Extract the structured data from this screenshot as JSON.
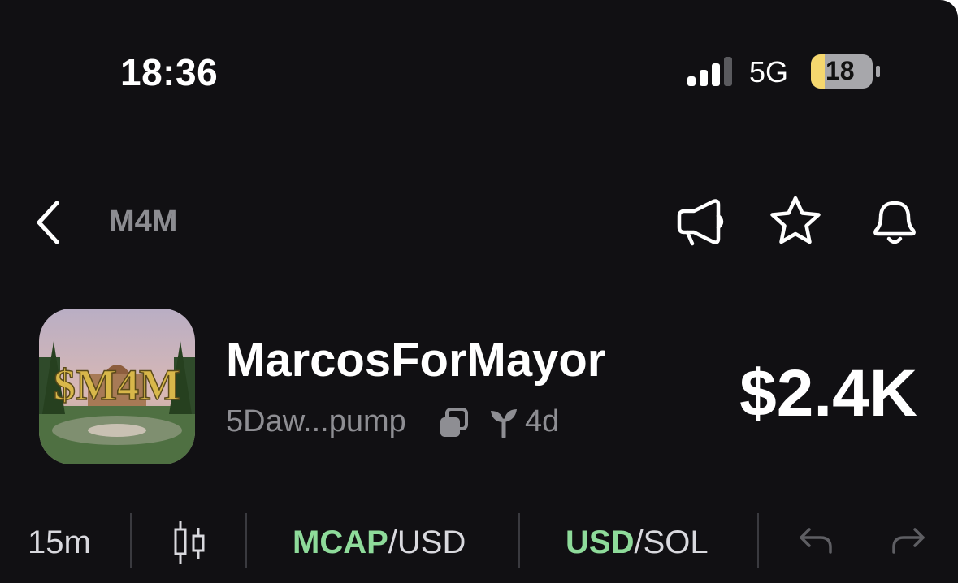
{
  "status_bar": {
    "time": "18:36",
    "network": "5G",
    "battery": "18"
  },
  "nav": {
    "title": "M4M",
    "icons": [
      "chevron-left-icon",
      "megaphone-icon",
      "star-icon",
      "bell-icon"
    ]
  },
  "token": {
    "name": "MarcosForMayor",
    "ticker_art": "$M4M",
    "address": "5Daw...pump",
    "age": "4d",
    "price": "$2.4K"
  },
  "toolbar": {
    "interval": "15m",
    "mcap_label": "MCAP",
    "mcap_unit": "/USD",
    "currency_label": "USD",
    "currency_unit": "/SOL",
    "icons": [
      "candlestick-icon",
      "undo-icon",
      "redo-icon"
    ]
  },
  "colors": {
    "background": "#111013",
    "accent_green": "#8edb9a",
    "muted": "#8e8e93",
    "battery_low": "#f5d76e"
  }
}
